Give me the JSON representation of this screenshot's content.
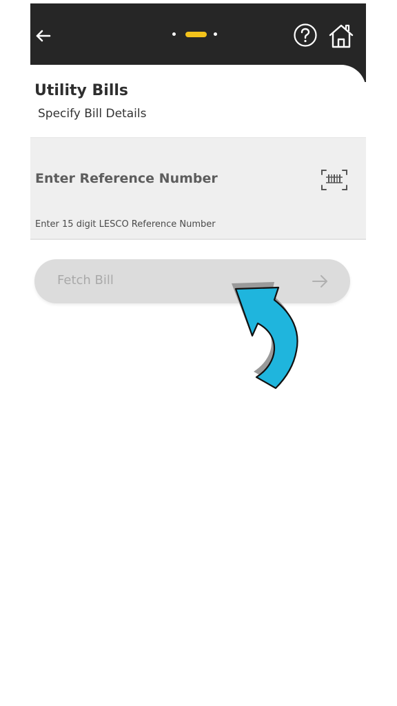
{
  "header": {
    "back_icon": "arrow-left-icon",
    "help_icon": "question-circle-icon",
    "home_icon": "home-icon",
    "step_indicator": {
      "total_steps": 3,
      "active_step": 2,
      "active_color": "#f2c21b"
    }
  },
  "page": {
    "title": "Utility Bills",
    "subtitle": "Specify Bill Details"
  },
  "reference": {
    "label": "Enter Reference Number",
    "hint": "Enter 15 digit LESCO Reference Number",
    "scan_icon": "barcode-scan-icon"
  },
  "fetch": {
    "label": "Fetch Bill",
    "arrow_icon": "arrow-right-icon",
    "enabled": false
  },
  "overlay": {
    "pointer_icon": "curved-arrow-pointer-icon",
    "pointer_color": "#1fb5dd"
  }
}
